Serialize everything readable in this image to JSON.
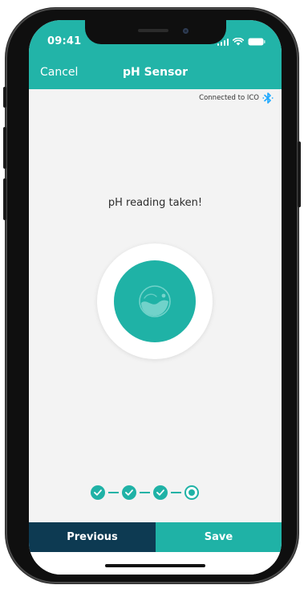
{
  "status_bar": {
    "time": "09:41",
    "icons": [
      "signal-icon",
      "wifi-icon",
      "battery-icon"
    ]
  },
  "nav": {
    "cancel_label": "Cancel",
    "title": "pH Sensor"
  },
  "connection": {
    "text": "Connected to ICO",
    "icon": "bluetooth-icon"
  },
  "main": {
    "message": "pH reading taken!",
    "sensor_icon": "water-drop-icon"
  },
  "progress": {
    "total_steps": 4,
    "completed_steps": 3,
    "current_step": 4
  },
  "actions": {
    "previous_label": "Previous",
    "save_label": "Save"
  },
  "colors": {
    "primary": "#22b4a8",
    "dark": "#0d3a52",
    "background": "#f3f3f3",
    "bluetooth": "#1da8ff"
  }
}
